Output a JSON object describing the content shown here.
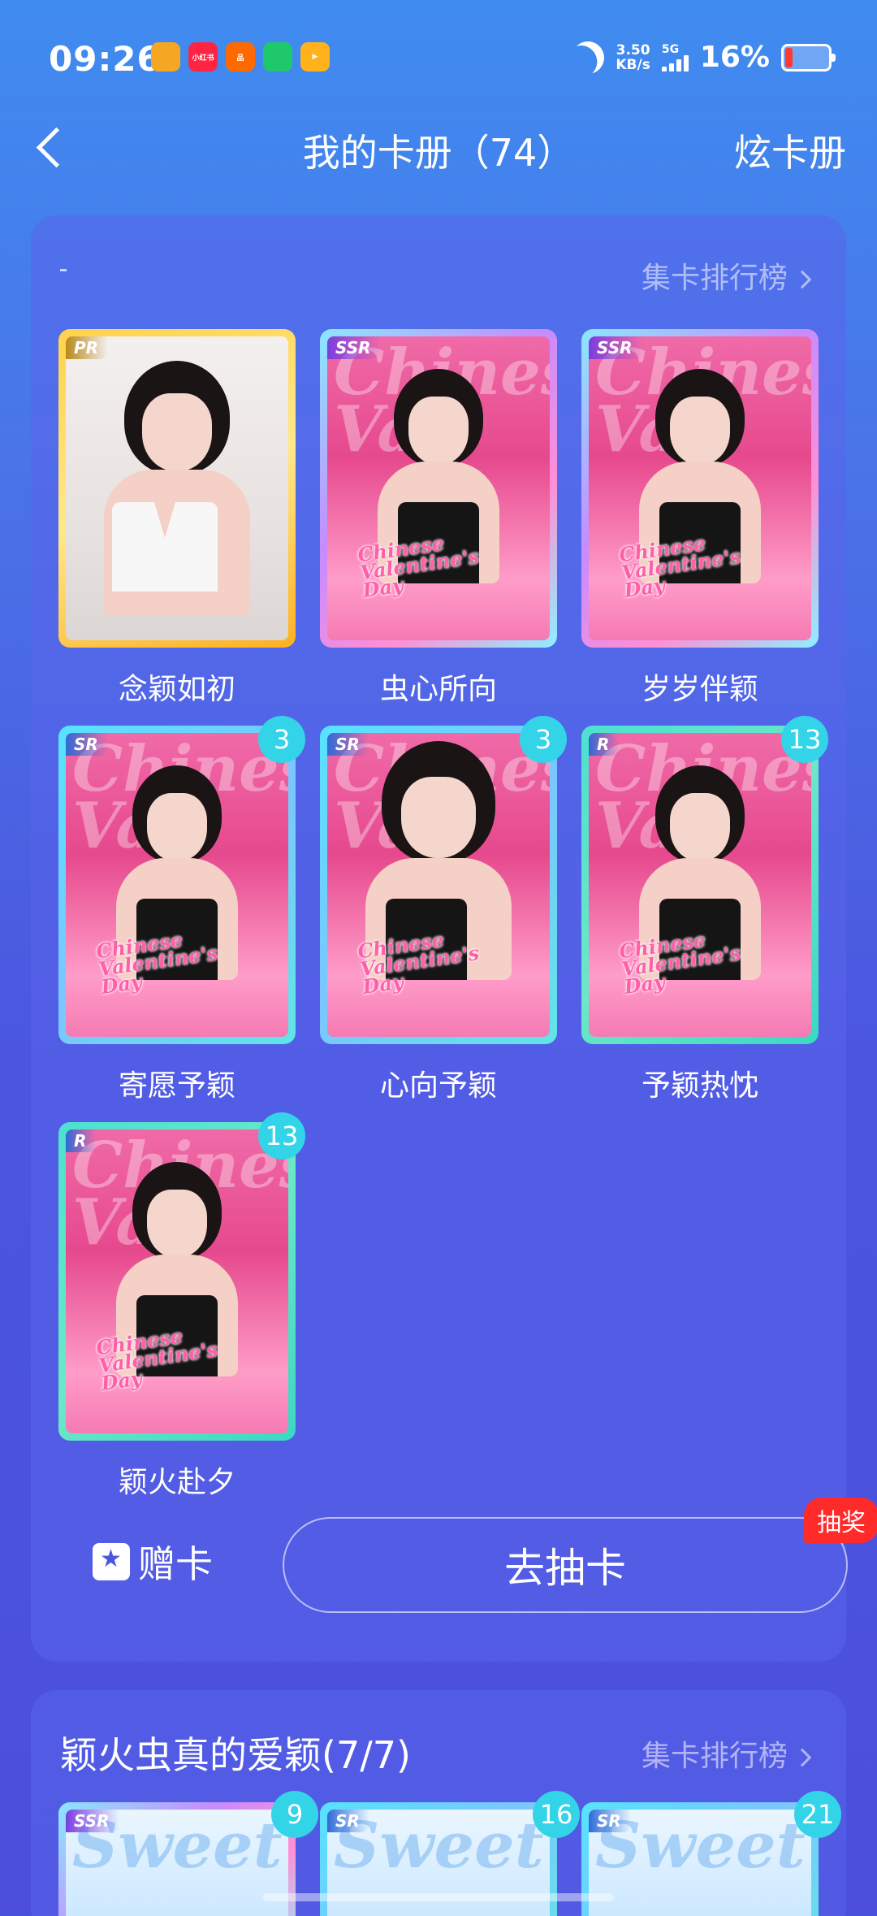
{
  "status_bar": {
    "time": "09:26",
    "net_speed": "3.50",
    "net_unit": "KB/s",
    "network": "5G",
    "battery": "16%",
    "apps": [
      {
        "name": "weibo-icon",
        "color": "#f5a623",
        "label": ""
      },
      {
        "name": "xiaohongshu-icon",
        "color": "#ff2442",
        "label": "小红书"
      },
      {
        "name": "taobao-icon",
        "color": "#ff6a00",
        "label": "品"
      },
      {
        "name": "chat-app-icon",
        "color": "#1fc96b",
        "label": ""
      },
      {
        "name": "video-app-icon",
        "color": "#ffb21a",
        "label": "▶"
      }
    ]
  },
  "header": {
    "title": "我的卡册（74）",
    "right_action": "炫卡册"
  },
  "album1": {
    "rank_link": "集卡排行榜",
    "cards": [
      {
        "name": "念颖如初",
        "rarity": "PR",
        "count": ""
      },
      {
        "name": "虫心所向",
        "rarity": "SSR",
        "count": ""
      },
      {
        "name": "岁岁伴颖",
        "rarity": "SSR",
        "count": ""
      },
      {
        "name": "寄愿予颖",
        "rarity": "SR",
        "count": "3"
      },
      {
        "name": "心向予颖",
        "rarity": "SR",
        "count": "3"
      },
      {
        "name": "予颖热忱",
        "rarity": "R",
        "count": "13"
      },
      {
        "name": "颖火赴夕",
        "rarity": "R",
        "count": "13"
      }
    ],
    "gift_label": "赠卡",
    "draw_label": "去抽卡",
    "lottery_badge": "抽奖"
  },
  "album2": {
    "title": "颖火虫真的爱颖(7/7)",
    "rank_link": "集卡排行榜",
    "cards": [
      {
        "rarity": "SSR",
        "count": "9"
      },
      {
        "rarity": "SR",
        "count": "16"
      },
      {
        "rarity": "SR",
        "count": "21"
      }
    ]
  }
}
